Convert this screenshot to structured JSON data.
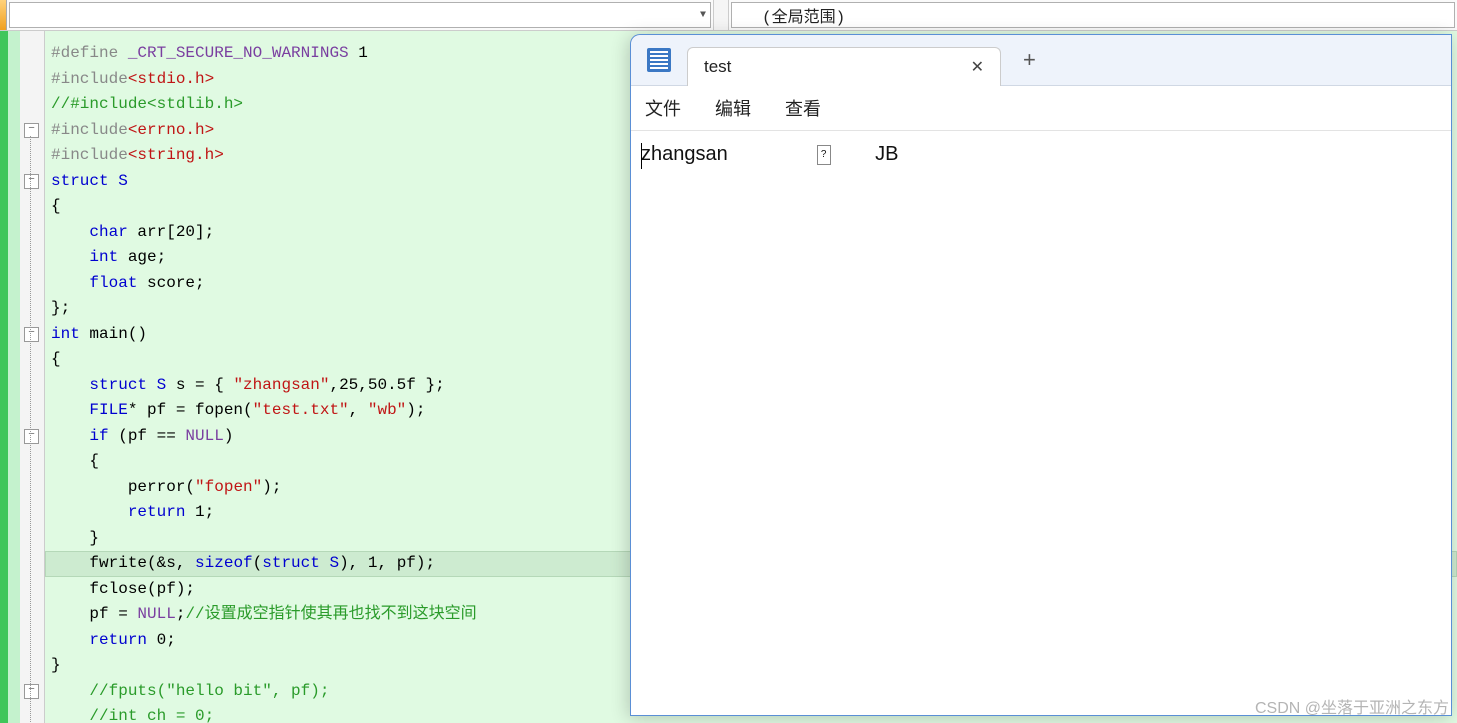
{
  "topbar": {
    "scope_label": "(全局范围)"
  },
  "code": {
    "lines": [
      {
        "gut": "",
        "seg": [
          {
            "c": "pp",
            "t": "#define "
          },
          {
            "c": "macro",
            "t": "_CRT_SECURE_NO_WARNINGS"
          },
          {
            "c": "plain",
            "t": " 1"
          }
        ]
      },
      {
        "gut": "",
        "seg": [
          {
            "c": "pp",
            "t": "#include"
          },
          {
            "c": "incpath",
            "t": "<stdio.h>"
          }
        ]
      },
      {
        "gut": "",
        "seg": [
          {
            "c": "cm",
            "t": "//#include<stdlib.h>"
          }
        ]
      },
      {
        "gut": "-",
        "seg": [
          {
            "c": "pp",
            "t": "#include"
          },
          {
            "c": "incpath",
            "t": "<errno.h>"
          }
        ],
        "noindent": true
      },
      {
        "gut": "|",
        "seg": [
          {
            "c": "pp",
            "t": "#include"
          },
          {
            "c": "incpath",
            "t": "<string.h>"
          }
        ],
        "noindent": true
      },
      {
        "gut": "-",
        "seg": [
          {
            "c": "kw",
            "t": "struct"
          },
          {
            "c": "plain",
            "t": " "
          },
          {
            "c": "type",
            "t": "S"
          }
        ],
        "noindent": true
      },
      {
        "gut": "|",
        "seg": [
          {
            "c": "plain",
            "t": "{"
          }
        ],
        "noindent": true
      },
      {
        "gut": "|",
        "seg": [
          {
            "c": "plain",
            "t": "    "
          },
          {
            "c": "kw",
            "t": "char"
          },
          {
            "c": "plain",
            "t": " arr[20];"
          }
        ]
      },
      {
        "gut": "|",
        "seg": [
          {
            "c": "plain",
            "t": "    "
          },
          {
            "c": "kw",
            "t": "int"
          },
          {
            "c": "plain",
            "t": " age;"
          }
        ]
      },
      {
        "gut": "|",
        "seg": [
          {
            "c": "plain",
            "t": "    "
          },
          {
            "c": "kw",
            "t": "float"
          },
          {
            "c": "plain",
            "t": " score;"
          }
        ]
      },
      {
        "gut": "|",
        "seg": [
          {
            "c": "plain",
            "t": "};"
          }
        ],
        "noindent": true
      },
      {
        "gut": "-",
        "seg": [
          {
            "c": "kw",
            "t": "int"
          },
          {
            "c": "plain",
            "t": " "
          },
          {
            "c": "fn",
            "t": "main"
          },
          {
            "c": "plain",
            "t": "()"
          }
        ],
        "noindent": true
      },
      {
        "gut": "|",
        "seg": [
          {
            "c": "plain",
            "t": "{"
          }
        ],
        "noindent": true
      },
      {
        "gut": "|",
        "seg": [
          {
            "c": "plain",
            "t": "    "
          },
          {
            "c": "kw",
            "t": "struct"
          },
          {
            "c": "plain",
            "t": " "
          },
          {
            "c": "type",
            "t": "S"
          },
          {
            "c": "plain",
            "t": " s = { "
          },
          {
            "c": "str",
            "t": "\"zhangsan\""
          },
          {
            "c": "plain",
            "t": ",25,50.5f };"
          }
        ]
      },
      {
        "gut": "|",
        "seg": [
          {
            "c": "plain",
            "t": "    "
          },
          {
            "c": "type",
            "t": "FILE"
          },
          {
            "c": "plain",
            "t": "* pf = fopen("
          },
          {
            "c": "str",
            "t": "\"test.txt\""
          },
          {
            "c": "plain",
            "t": ", "
          },
          {
            "c": "str",
            "t": "\"wb\""
          },
          {
            "c": "plain",
            "t": ");"
          }
        ]
      },
      {
        "gut": "-",
        "seg": [
          {
            "c": "plain",
            "t": "    "
          },
          {
            "c": "kw",
            "t": "if"
          },
          {
            "c": "plain",
            "t": " (pf == "
          },
          {
            "c": "null",
            "t": "NULL"
          },
          {
            "c": "plain",
            "t": ")"
          }
        ],
        "fold_indent": true
      },
      {
        "gut": "|",
        "seg": [
          {
            "c": "plain",
            "t": "    {"
          }
        ]
      },
      {
        "gut": "|",
        "seg": [
          {
            "c": "plain",
            "t": "        perror("
          },
          {
            "c": "str",
            "t": "\"fopen\""
          },
          {
            "c": "plain",
            "t": ");"
          }
        ]
      },
      {
        "gut": "|",
        "seg": [
          {
            "c": "plain",
            "t": "        "
          },
          {
            "c": "kw",
            "t": "return"
          },
          {
            "c": "plain",
            "t": " 1;"
          }
        ]
      },
      {
        "gut": "|",
        "seg": [
          {
            "c": "plain",
            "t": "    }"
          }
        ]
      },
      {
        "gut": "|",
        "hl": true,
        "seg": [
          {
            "c": "plain",
            "t": "    fwrite(&s, "
          },
          {
            "c": "kw",
            "t": "sizeof"
          },
          {
            "c": "plain",
            "t": "("
          },
          {
            "c": "kw",
            "t": "struct"
          },
          {
            "c": "plain",
            "t": " "
          },
          {
            "c": "type",
            "t": "S"
          },
          {
            "c": "plain",
            "t": "), 1, pf);"
          }
        ]
      },
      {
        "gut": "|",
        "seg": [
          {
            "c": "plain",
            "t": "    fclose(pf);"
          }
        ]
      },
      {
        "gut": "|",
        "seg": [
          {
            "c": "plain",
            "t": "    pf = "
          },
          {
            "c": "null",
            "t": "NULL"
          },
          {
            "c": "plain",
            "t": ";"
          },
          {
            "c": "cm",
            "t": "//设置成空指针使其再也找不到这块空间"
          }
        ]
      },
      {
        "gut": "|",
        "seg": [
          {
            "c": "plain",
            "t": "    "
          },
          {
            "c": "kw",
            "t": "return"
          },
          {
            "c": "plain",
            "t": " 0;"
          }
        ]
      },
      {
        "gut": "|",
        "seg": [
          {
            "c": "plain",
            "t": "}"
          }
        ],
        "noindent": true
      },
      {
        "gut": "-",
        "seg": [
          {
            "c": "plain",
            "t": "    "
          },
          {
            "c": "cm",
            "t": "//fputs(\"hello bit\", pf);"
          }
        ],
        "fold_indent": true
      },
      {
        "gut": "|",
        "seg": [
          {
            "c": "plain",
            "t": "    "
          },
          {
            "c": "cm",
            "t": "//int ch = 0;"
          }
        ]
      }
    ]
  },
  "notepad": {
    "tab_title": "test",
    "menus": [
      "文件",
      "编辑",
      "查看"
    ],
    "body_col1": "zhangsan",
    "body_col3": "JB"
  },
  "watermark": "CSDN @坐落于亚洲之东方"
}
